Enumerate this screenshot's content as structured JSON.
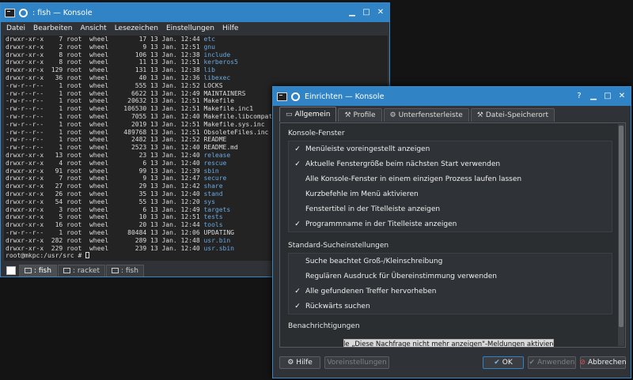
{
  "konsole": {
    "title": ": fish — Konsole",
    "menu": [
      "Datei",
      "Bearbeiten",
      "Ansicht",
      "Lesezeichen",
      "Einstellungen",
      "Hilfe"
    ],
    "listing": [
      [
        "drwxr-xr-x",
        "7",
        "root",
        "wheel",
        "17",
        "13 Jan. 12:44",
        "etc"
      ],
      [
        "drwxr-xr-x",
        "2",
        "root",
        "wheel",
        "9",
        "13 Jan. 12:51",
        "gnu"
      ],
      [
        "drwxr-xr-x",
        "8",
        "root",
        "wheel",
        "106",
        "13 Jan. 12:38",
        "include"
      ],
      [
        "drwxr-xr-x",
        "8",
        "root",
        "wheel",
        "11",
        "13 Jan. 12:51",
        "kerberos5"
      ],
      [
        "drwxr-xr-x",
        "129",
        "root",
        "wheel",
        "131",
        "13 Jan. 12:38",
        "lib"
      ],
      [
        "drwxr-xr-x",
        "36",
        "root",
        "wheel",
        "40",
        "13 Jan. 12:36",
        "libexec"
      ],
      [
        "-rw-r--r--",
        "1",
        "root",
        "wheel",
        "555",
        "13 Jan. 12:52",
        "LOCKS"
      ],
      [
        "-rw-r--r--",
        "1",
        "root",
        "wheel",
        "6622",
        "13 Jan. 12:49",
        "MAINTAINERS"
      ],
      [
        "-rw-r--r--",
        "1",
        "root",
        "wheel",
        "20632",
        "13 Jan. 12:51",
        "Makefile"
      ],
      [
        "-rw-r--r--",
        "1",
        "root",
        "wheel",
        "106530",
        "13 Jan. 12:51",
        "Makefile.inc1"
      ],
      [
        "-rw-r--r--",
        "1",
        "root",
        "wheel",
        "7055",
        "13 Jan. 12:40",
        "Makefile.libcompat"
      ],
      [
        "-rw-r--r--",
        "1",
        "root",
        "wheel",
        "2019",
        "13 Jan. 12:51",
        "Makefile.sys.inc"
      ],
      [
        "-rw-r--r--",
        "1",
        "root",
        "wheel",
        "489768",
        "13 Jan. 12:51",
        "ObsoleteFiles.inc"
      ],
      [
        "-rw-r--r--",
        "1",
        "root",
        "wheel",
        "2482",
        "13 Jan. 12:52",
        "README"
      ],
      [
        "-rw-r--r--",
        "1",
        "root",
        "wheel",
        "2523",
        "13 Jan. 12:40",
        "README.md"
      ],
      [
        "drwxr-xr-x",
        "13",
        "root",
        "wheel",
        "23",
        "13 Jan. 12:40",
        "release"
      ],
      [
        "drwxr-xr-x",
        "4",
        "root",
        "wheel",
        "6",
        "13 Jan. 12:40",
        "rescue"
      ],
      [
        "drwxr-xr-x",
        "91",
        "root",
        "wheel",
        "99",
        "13 Jan. 12:39",
        "sbin"
      ],
      [
        "drwxr-xr-x",
        "7",
        "root",
        "wheel",
        "9",
        "13 Jan. 12:47",
        "secure"
      ],
      [
        "drwxr-xr-x",
        "27",
        "root",
        "wheel",
        "29",
        "13 Jan. 12:42",
        "share"
      ],
      [
        "drwxr-xr-x",
        "26",
        "root",
        "wheel",
        "35",
        "13 Jan. 12:40",
        "stand"
      ],
      [
        "drwxr-xr-x",
        "54",
        "root",
        "wheel",
        "55",
        "13 Jan. 12:20",
        "sys"
      ],
      [
        "drwxr-xr-x",
        "3",
        "root",
        "wheel",
        "6",
        "13 Jan. 12:49",
        "targets"
      ],
      [
        "drwxr-xr-x",
        "5",
        "root",
        "wheel",
        "10",
        "13 Jan. 12:51",
        "tests"
      ],
      [
        "drwxr-xr-x",
        "16",
        "root",
        "wheel",
        "20",
        "13 Jan. 12:44",
        "tools"
      ],
      [
        "-rw-r--r--",
        "1",
        "root",
        "wheel",
        "80484",
        "13 Jan. 12:06",
        "UPDATING"
      ],
      [
        "drwxr-xr-x",
        "282",
        "root",
        "wheel",
        "289",
        "13 Jan. 12:48",
        "usr.bin"
      ],
      [
        "drwxr-xr-x",
        "229",
        "root",
        "wheel",
        "239",
        "13 Jan. 12:40",
        "usr.sbin"
      ]
    ],
    "prompt": "root@mkpc:/usr/src # ",
    "tabs": [
      ": fish",
      ": racket",
      ": fish"
    ]
  },
  "settings": {
    "title": "Einrichten — Konsole",
    "tabs": [
      "Allgemein",
      "Profile",
      "Unterfensterleiste",
      "Datei-Speicherort"
    ],
    "sections": {
      "window": "Konsole-Fenster",
      "search": "Standard-Sucheinstellungen",
      "notify": "Benachrichtigungen"
    },
    "window_options": [
      {
        "label": "Menüleiste voreingestellt anzeigen",
        "checked": true
      },
      {
        "label": "Aktuelle Fenstergröße beim nächsten Start verwenden",
        "checked": true
      },
      {
        "label": "Alle Konsole-Fenster in einem einzigen Prozess laufen lassen",
        "checked": false
      },
      {
        "label": "Kurzbefehle im Menü aktivieren",
        "checked": false
      },
      {
        "label": "Fenstertitel in der Titelleiste anzeigen",
        "checked": false
      },
      {
        "label": "Programmname in der Titelleiste anzeigen",
        "checked": true
      }
    ],
    "search_options": [
      {
        "label": "Suche beachtet Groß-/Kleinschreibung",
        "checked": false
      },
      {
        "label": "Regulären Ausdruck für Übereinstimmung verwenden",
        "checked": false
      },
      {
        "label": "Alle gefundenen Treffer hervorheben",
        "checked": true
      },
      {
        "label": "Rückwärts suchen",
        "checked": true
      }
    ],
    "notify_button": "Alle „Diese Nachfrage nicht mehr anzeigen\"-Meldungen aktivieren",
    "buttons": {
      "help": "Hilfe",
      "defaults": "Voreinstellungen",
      "ok": "OK",
      "apply": "Anwenden",
      "cancel": "Abbrechen"
    }
  },
  "colors": {
    "accent": "#3083c4",
    "dir_name": "#6aa8e0",
    "terminal_bg": "#232323",
    "window_bg": "#2f3236"
  }
}
